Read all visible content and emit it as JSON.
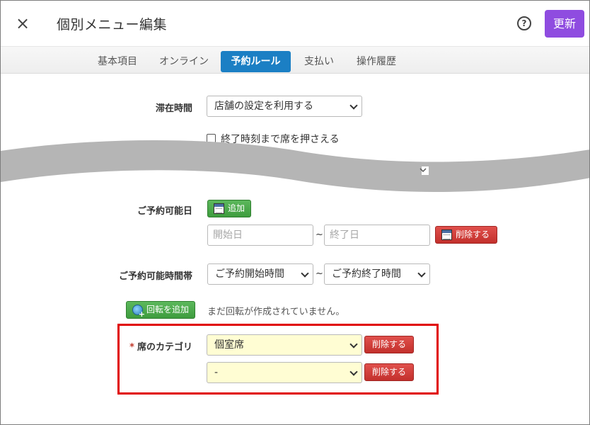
{
  "header": {
    "close_glyph": "×",
    "title": "個別メニュー編集",
    "help_glyph": "?",
    "update_label": "更新"
  },
  "tabs": [
    {
      "label": "基本項目",
      "active": false
    },
    {
      "label": "オンライン",
      "active": false
    },
    {
      "label": "予約ルール",
      "active": true
    },
    {
      "label": "支払い",
      "active": false
    },
    {
      "label": "操作履歴",
      "active": false
    }
  ],
  "form": {
    "stay_time": {
      "label": "滞在時間",
      "value": "店舗の設定を利用する",
      "hold_checkbox_label": "終了時刻まで席を押さえる",
      "hold_checked": false
    },
    "available_dates": {
      "label": "ご予約可能日",
      "add_label": "追加",
      "start_placeholder": "開始日",
      "end_placeholder": "終了日",
      "separator": "~",
      "delete_label": "削除する"
    },
    "available_time": {
      "label": "ご予約可能時間帯",
      "start_value": "ご予約開始時間",
      "end_value": "ご予約終了時間",
      "separator": "~"
    },
    "rotation": {
      "add_label": "回転を追加",
      "note": "まだ回転が作成されていません。"
    },
    "seat_category": {
      "required_mark": "*",
      "label": "席のカテゴリ",
      "rows": [
        {
          "value": "個室席",
          "delete_label": "削除する"
        },
        {
          "value": "-",
          "delete_label": "削除する"
        }
      ]
    }
  },
  "colors": {
    "accent_purple": "#8f4ce0",
    "tab_active": "#1b7fc4",
    "highlight_red": "#e00000",
    "select_yellow": "#fffdd3",
    "wave_gray": "#b5b5b5"
  }
}
